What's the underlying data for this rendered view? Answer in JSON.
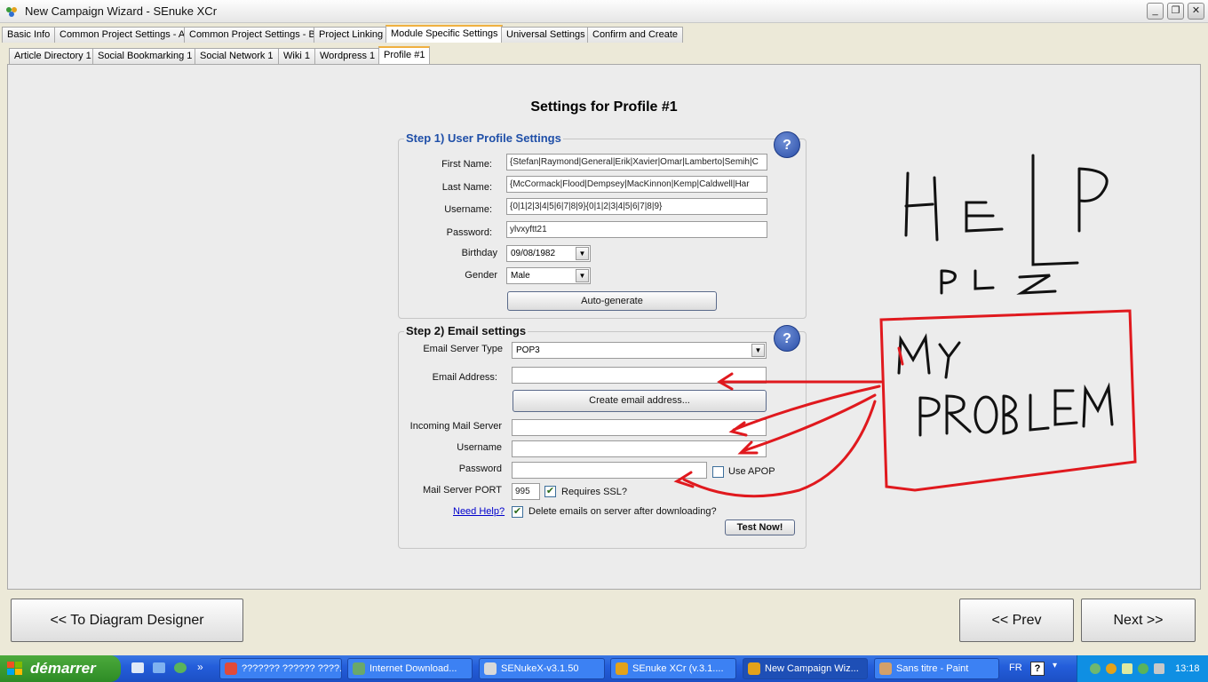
{
  "window": {
    "title": "New Campaign Wizard - SEnuke XCr"
  },
  "main_tabs": [
    "Basic Info",
    "Common Project Settings - A",
    "Common Project Settings - B",
    "Project Linking",
    "Module Specific Settings",
    "Universal Settings",
    "Confirm and Create"
  ],
  "sub_tabs": [
    "Article Directory 1",
    "Social Bookmarking 1",
    "Social Network 1",
    "Wiki 1",
    "Wordpress 1",
    "Profile #1"
  ],
  "page_title": "Settings for Profile #1",
  "step1": {
    "title": "Step 1) User Profile Settings",
    "help": "?",
    "first_name_label": "First Name:",
    "first_name": "{Stefan|Raymond|General|Erik|Xavier|Omar|Lamberto|Semih|C",
    "last_name_label": "Last Name:",
    "last_name": "{McCormack|Flood|Dempsey|MacKinnon|Kemp|Caldwell|Har",
    "username_label": "Username:",
    "username": "{0|1|2|3|4|5|6|7|8|9}{0|1|2|3|4|5|6|7|8|9}",
    "password_label": "Password:",
    "password": "ylvxyftt21",
    "birthday_label": "Birthday",
    "birthday": "09/08/1982",
    "gender_label": "Gender",
    "gender": "Male",
    "autogen_label": "Auto-generate"
  },
  "step2": {
    "title": "Step 2) Email settings",
    "help": "?",
    "server_type_label": "Email Server Type",
    "server_type": "POP3",
    "email_label": "Email Address:",
    "email": "",
    "create_email_label": "Create email address...",
    "incoming_label": "Incoming Mail Server",
    "incoming": "",
    "username_label": "Username",
    "username": "",
    "password_label": "Password",
    "password": "",
    "apop_label": "Use APOP",
    "port_label": "Mail Server PORT",
    "port": "995",
    "ssl_label": "Requires SSL?",
    "need_help": "Need Help?",
    "delete_label": "Delete emails on server after downloading?",
    "test_label": "Test Now!"
  },
  "footer": {
    "diagram": "<< To Diagram Designer",
    "prev": "<< Prev",
    "next": "Next >>"
  },
  "annotation": {
    "help": "HELP",
    "plz": "PLZ",
    "my": "MY",
    "problem": "PROBLEM",
    "color": "#e0191e"
  },
  "taskbar": {
    "start": "démarrer",
    "tasks": [
      "??????? ?????? ????...",
      "Internet Download...",
      "SENukeX-v3.1.50",
      "SEnuke XCr (v.3.1....",
      "New Campaign Wiz...",
      "Sans titre - Paint"
    ],
    "lang": "FR",
    "time": "13:18"
  }
}
